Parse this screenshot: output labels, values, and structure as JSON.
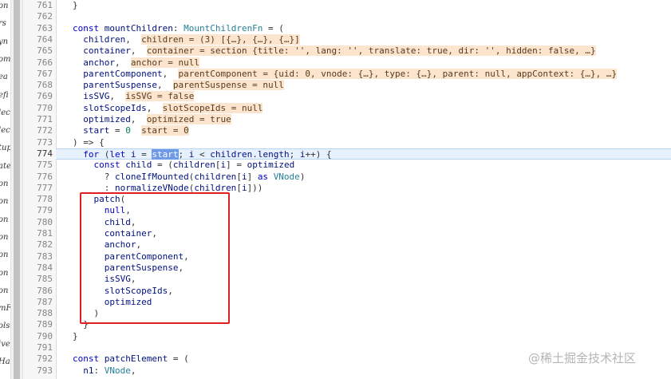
{
  "sidebar_fragments": [
    "on",
    "rs",
    "yn",
    "om",
    "ea",
    "efi",
    "lec",
    "lec",
    "tup",
    "ate",
    "on",
    "on",
    "on",
    "on",
    "on",
    "on",
    "on",
    "mF",
    "ols",
    "ive",
    "Ha"
  ],
  "gutter_numbers": [
    "761",
    "762",
    "763",
    "764",
    "765",
    "766",
    "767",
    "768",
    "769",
    "770",
    "771",
    "772",
    "773",
    "774",
    "775",
    "776",
    "777",
    "778",
    "779",
    "780",
    "781",
    "782",
    "783",
    "784",
    "785",
    "786",
    "787",
    "788",
    "789",
    "790",
    "791",
    "792",
    "793"
  ],
  "active_line": "774",
  "code_lines": [
    [
      {
        "t": "pl",
        "v": "}"
      }
    ],
    [],
    [
      {
        "t": "kw",
        "v": "const "
      },
      {
        "t": "id",
        "v": "mountChildren"
      },
      {
        "t": "pl",
        "v": ": "
      },
      {
        "t": "type",
        "v": "MountChildrenFn"
      },
      {
        "t": "pl",
        "v": " = ("
      }
    ],
    [
      {
        "t": "pl",
        "v": "  "
      },
      {
        "t": "id",
        "v": "children"
      },
      {
        "t": "pl",
        "v": ",  "
      },
      {
        "t": "hint",
        "v": "children = (3) [{…}, {…}, {…}]"
      }
    ],
    [
      {
        "t": "pl",
        "v": "  "
      },
      {
        "t": "id",
        "v": "container"
      },
      {
        "t": "pl",
        "v": ",  "
      },
      {
        "t": "hint",
        "v": "container = section {title: '', lang: '', translate: true, dir: '', hidden: false, …}"
      }
    ],
    [
      {
        "t": "pl",
        "v": "  "
      },
      {
        "t": "id",
        "v": "anchor"
      },
      {
        "t": "pl",
        "v": ",  "
      },
      {
        "t": "hint",
        "v": "anchor = null"
      }
    ],
    [
      {
        "t": "pl",
        "v": "  "
      },
      {
        "t": "id",
        "v": "parentComponent"
      },
      {
        "t": "pl",
        "v": ",  "
      },
      {
        "t": "hint",
        "v": "parentComponent = {uid: 0, vnode: {…}, type: {…}, parent: null, appContext: {…}, …}"
      }
    ],
    [
      {
        "t": "pl",
        "v": "  "
      },
      {
        "t": "id",
        "v": "parentSuspense"
      },
      {
        "t": "pl",
        "v": ",  "
      },
      {
        "t": "hint",
        "v": "parentSuspense = null"
      }
    ],
    [
      {
        "t": "pl",
        "v": "  "
      },
      {
        "t": "id",
        "v": "isSVG"
      },
      {
        "t": "pl",
        "v": ",  "
      },
      {
        "t": "hint",
        "v": "isSVG = false"
      }
    ],
    [
      {
        "t": "pl",
        "v": "  "
      },
      {
        "t": "id",
        "v": "slotScopeIds"
      },
      {
        "t": "pl",
        "v": ",  "
      },
      {
        "t": "hint",
        "v": "slotScopeIds = null"
      }
    ],
    [
      {
        "t": "pl",
        "v": "  "
      },
      {
        "t": "id",
        "v": "optimized"
      },
      {
        "t": "pl",
        "v": ",  "
      },
      {
        "t": "hint",
        "v": "optimized = true"
      }
    ],
    [
      {
        "t": "pl",
        "v": "  "
      },
      {
        "t": "id",
        "v": "start"
      },
      {
        "t": "pl",
        "v": " = "
      },
      {
        "t": "num",
        "v": "0"
      },
      {
        "t": "pl",
        "v": "  "
      },
      {
        "t": "hint",
        "v": "start = 0"
      }
    ],
    [
      {
        "t": "pl",
        "v": ") => {"
      }
    ],
    [
      {
        "t": "pl",
        "v": "  "
      },
      {
        "t": "kw",
        "v": "for"
      },
      {
        "t": "pl",
        "v": " ("
      },
      {
        "t": "kw",
        "v": "let "
      },
      {
        "t": "id",
        "v": "i"
      },
      {
        "t": "pl",
        "v": " = "
      },
      {
        "t": "sel",
        "v": "start"
      },
      {
        "t": "pl",
        "v": "; "
      },
      {
        "t": "id",
        "v": "i"
      },
      {
        "t": "pl",
        "v": " < "
      },
      {
        "t": "id",
        "v": "children"
      },
      {
        "t": "pl",
        "v": "."
      },
      {
        "t": "id",
        "v": "length"
      },
      {
        "t": "pl",
        "v": "; "
      },
      {
        "t": "id",
        "v": "i"
      },
      {
        "t": "pl",
        "v": "++) {"
      }
    ],
    [
      {
        "t": "pl",
        "v": "    "
      },
      {
        "t": "kw",
        "v": "const "
      },
      {
        "t": "id",
        "v": "child"
      },
      {
        "t": "pl",
        "v": " = ("
      },
      {
        "t": "id",
        "v": "children"
      },
      {
        "t": "pl",
        "v": "["
      },
      {
        "t": "id",
        "v": "i"
      },
      {
        "t": "pl",
        "v": "] = "
      },
      {
        "t": "id",
        "v": "optimized"
      }
    ],
    [
      {
        "t": "pl",
        "v": "      ? "
      },
      {
        "t": "id",
        "v": "cloneIfMounted"
      },
      {
        "t": "pl",
        "v": "("
      },
      {
        "t": "id",
        "v": "children"
      },
      {
        "t": "pl",
        "v": "["
      },
      {
        "t": "id",
        "v": "i"
      },
      {
        "t": "pl",
        "v": "] "
      },
      {
        "t": "kw",
        "v": "as "
      },
      {
        "t": "type",
        "v": "VNode"
      },
      {
        "t": "pl",
        "v": ")"
      }
    ],
    [
      {
        "t": "pl",
        "v": "      : "
      },
      {
        "t": "id",
        "v": "normalizeVNode"
      },
      {
        "t": "pl",
        "v": "("
      },
      {
        "t": "id",
        "v": "children"
      },
      {
        "t": "pl",
        "v": "["
      },
      {
        "t": "id",
        "v": "i"
      },
      {
        "t": "pl",
        "v": "]))"
      }
    ],
    [
      {
        "t": "pl",
        "v": "    "
      },
      {
        "t": "id",
        "v": "patch"
      },
      {
        "t": "pl",
        "v": "("
      }
    ],
    [
      {
        "t": "pl",
        "v": "      "
      },
      {
        "t": "kw",
        "v": "null"
      },
      {
        "t": "pl",
        "v": ","
      }
    ],
    [
      {
        "t": "pl",
        "v": "      "
      },
      {
        "t": "id",
        "v": "child"
      },
      {
        "t": "pl",
        "v": ","
      }
    ],
    [
      {
        "t": "pl",
        "v": "      "
      },
      {
        "t": "id",
        "v": "container"
      },
      {
        "t": "pl",
        "v": ","
      }
    ],
    [
      {
        "t": "pl",
        "v": "      "
      },
      {
        "t": "id",
        "v": "anchor"
      },
      {
        "t": "pl",
        "v": ","
      }
    ],
    [
      {
        "t": "pl",
        "v": "      "
      },
      {
        "t": "id",
        "v": "parentComponent"
      },
      {
        "t": "pl",
        "v": ","
      }
    ],
    [
      {
        "t": "pl",
        "v": "      "
      },
      {
        "t": "id",
        "v": "parentSuspense"
      },
      {
        "t": "pl",
        "v": ","
      }
    ],
    [
      {
        "t": "pl",
        "v": "      "
      },
      {
        "t": "id",
        "v": "isSVG"
      },
      {
        "t": "pl",
        "v": ","
      }
    ],
    [
      {
        "t": "pl",
        "v": "      "
      },
      {
        "t": "id",
        "v": "slotScopeIds"
      },
      {
        "t": "pl",
        "v": ","
      }
    ],
    [
      {
        "t": "pl",
        "v": "      "
      },
      {
        "t": "id",
        "v": "optimized"
      }
    ],
    [
      {
        "t": "pl",
        "v": "    )"
      }
    ],
    [
      {
        "t": "pl",
        "v": "  }"
      }
    ],
    [
      {
        "t": "pl",
        "v": "}"
      }
    ],
    [],
    [
      {
        "t": "kw",
        "v": "const "
      },
      {
        "t": "id",
        "v": "patchElement"
      },
      {
        "t": "pl",
        "v": " = ("
      }
    ],
    [
      {
        "t": "pl",
        "v": "  "
      },
      {
        "t": "id",
        "v": "n1"
      },
      {
        "t": "pl",
        "v": ": "
      },
      {
        "t": "type",
        "v": "VNode"
      },
      {
        "t": "pl",
        "v": ","
      }
    ]
  ],
  "watermark": "@稀土掘金技术社区",
  "colors": {
    "keyword": "#0000c8",
    "type": "#267f99",
    "identifier": "#001080",
    "number": "#098658",
    "hint_bg": "#fbe5cf",
    "selection_bg": "#6e9ae6",
    "active_line_bg": "#e7f1fd",
    "annotation_box": "#e02020"
  }
}
